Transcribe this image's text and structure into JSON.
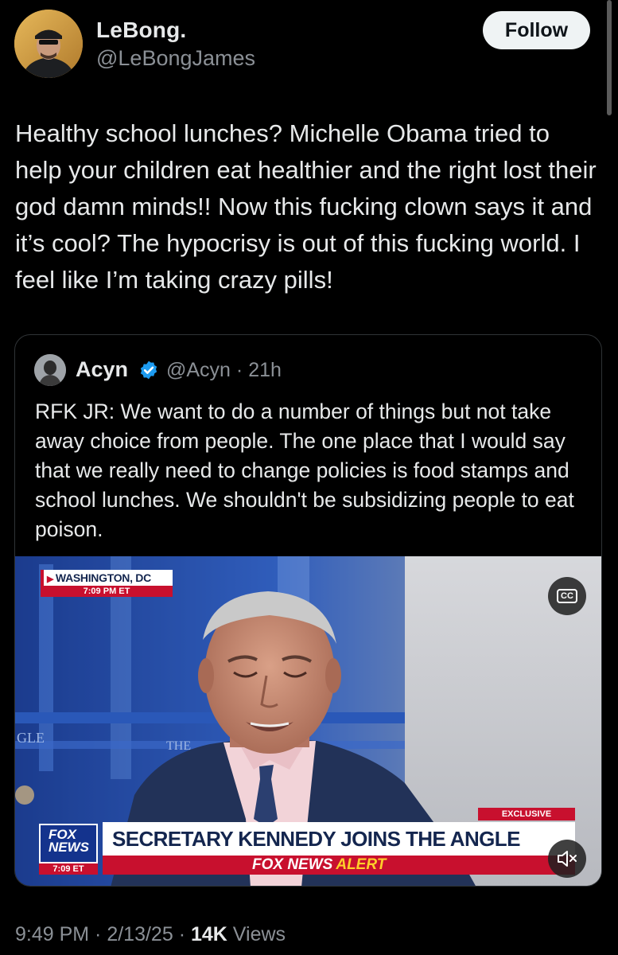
{
  "post": {
    "author_name": "LeBong.",
    "author_handle": "@LeBongJames",
    "follow_label": "Follow",
    "text": "Healthy school lunches? Michelle Obama tried to help your children eat healthier and the right lost their god damn minds!! Now this fucking clown says it and it’s cool? The hypocrisy is out of this fucking world. I feel like I’m taking crazy pills!",
    "time": "9:49 PM",
    "date": "2/13/25",
    "views_count": "14K",
    "views_label": "Views"
  },
  "quote": {
    "author_name": "Acyn",
    "author_handle": "@Acyn",
    "age": "21h",
    "text": "RFK JR: We want to do a number of things but not take away choice from people. The one place that I would say that we really need to change policies is food stamps and school lunches. We shouldn't be subsidizing people to eat poison.",
    "video": {
      "dateline_location": "WASHINGTON, DC",
      "dateline_time": "7:09 PM ET",
      "chyron_exclusive": "EXCLUSIVE",
      "chyron_headline": "SECRETARY KENNEDY JOINS THE ANGLE",
      "alert_brand": "FOX NEWS",
      "alert_word": "ALERT",
      "logo_line1": "FOX",
      "logo_line2": "NEWS",
      "logo_time": "7:09 ET",
      "cc_label": "CC",
      "backdrop_text_left": "GLE",
      "backdrop_text_mid": "THE"
    }
  },
  "colors": {
    "background": "#000000",
    "text_primary": "#e7e9ea",
    "text_secondary": "#8b9096",
    "verified_blue": "#1d9bf0",
    "fox_red": "#c8102e",
    "fox_navy": "#14264f"
  },
  "icons": [
    "verified-badge-icon",
    "cc-icon",
    "mute-icon"
  ]
}
